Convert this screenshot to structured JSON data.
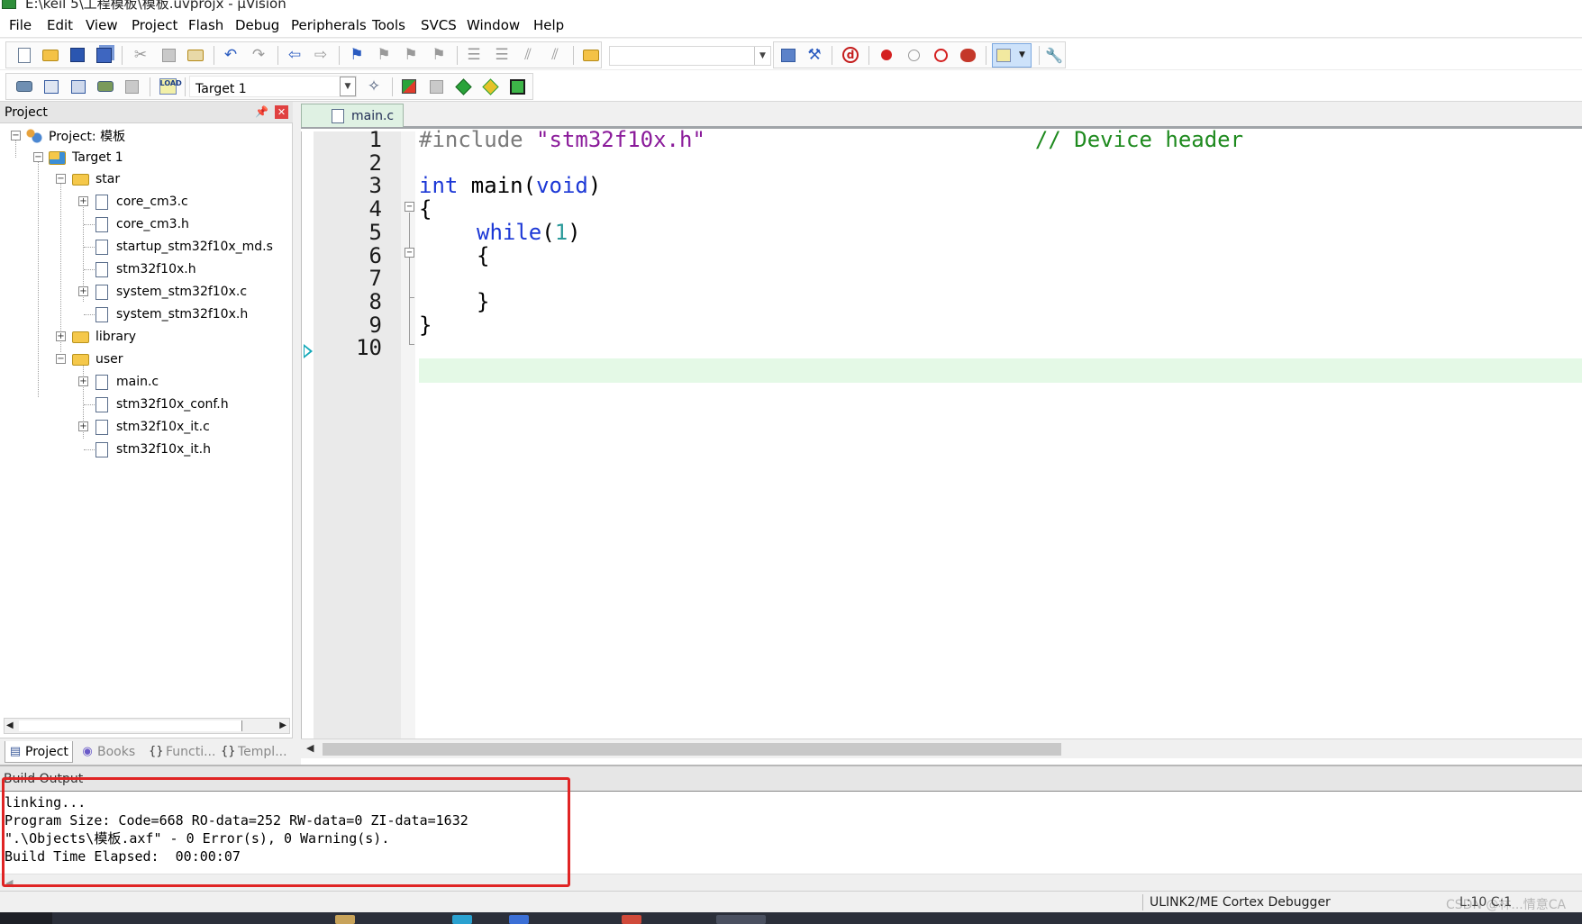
{
  "window": {
    "title": "E:\\keil 5\\工程模板\\模板.uvprojx - µVision"
  },
  "menu": [
    "File",
    "Edit",
    "View",
    "Project",
    "Flash",
    "Debug",
    "Peripherals",
    "Tools",
    "SVCS",
    "Window",
    "Help"
  ],
  "toolbar2": {
    "target_select": "Target 1",
    "load_label": "LOAD"
  },
  "project_panel": {
    "title": "Project",
    "tree": {
      "project": "Project: 模板",
      "target": "Target 1",
      "groups": [
        {
          "name": "star",
          "files": [
            "core_cm3.c",
            "core_cm3.h",
            "startup_stm32f10x_md.s",
            "stm32f10x.h",
            "system_stm32f10x.c",
            "system_stm32f10x.h"
          ]
        },
        {
          "name": "library",
          "files": []
        },
        {
          "name": "user",
          "files": [
            "main.c",
            "stm32f10x_conf.h",
            "stm32f10x_it.c",
            "stm32f10x_it.h"
          ]
        }
      ]
    },
    "tabs": [
      "Project",
      "Books",
      "Functi...",
      "Templ..."
    ]
  },
  "editor": {
    "tab": "main.c",
    "line_numbers": [
      "1",
      "2",
      "3",
      "4",
      "5",
      "6",
      "7",
      "8",
      "9",
      "10"
    ],
    "code": {
      "l1_directive": "#include",
      "l1_file": "\"stm32f10x.h\"",
      "l1_comment": "// Device header",
      "l3_type": "int",
      "l3_name": " main(",
      "l3_param": "void",
      "l3_close": ")",
      "l4": "{",
      "l5_kw": "while",
      "l5_open": "(",
      "l5_num": "1",
      "l5_close": ")",
      "l6": "{",
      "l8": "}",
      "l9": "}"
    }
  },
  "build_output": {
    "title": "Build Output",
    "lines": [
      "linking...",
      "Program Size: Code=668 RO-data=252 RW-data=0 ZI-data=1632",
      "\".\\Objects\\模板.axf\" - 0 Error(s), 0 Warning(s).",
      "Build Time Elapsed:  00:00:07"
    ]
  },
  "status_bar": {
    "debugger": "ULINK2/ME Cortex Debugger",
    "position": "L:10 C:1",
    "watermark": "CSDN @林...情意CA"
  },
  "colors": {
    "keyword": "#1c38d6",
    "string": "#8a1a9a",
    "comment": "#1e8a1e",
    "number": "#2a9a9a",
    "current_line": "#e4f9e6",
    "highlight_box": "#e02424"
  }
}
